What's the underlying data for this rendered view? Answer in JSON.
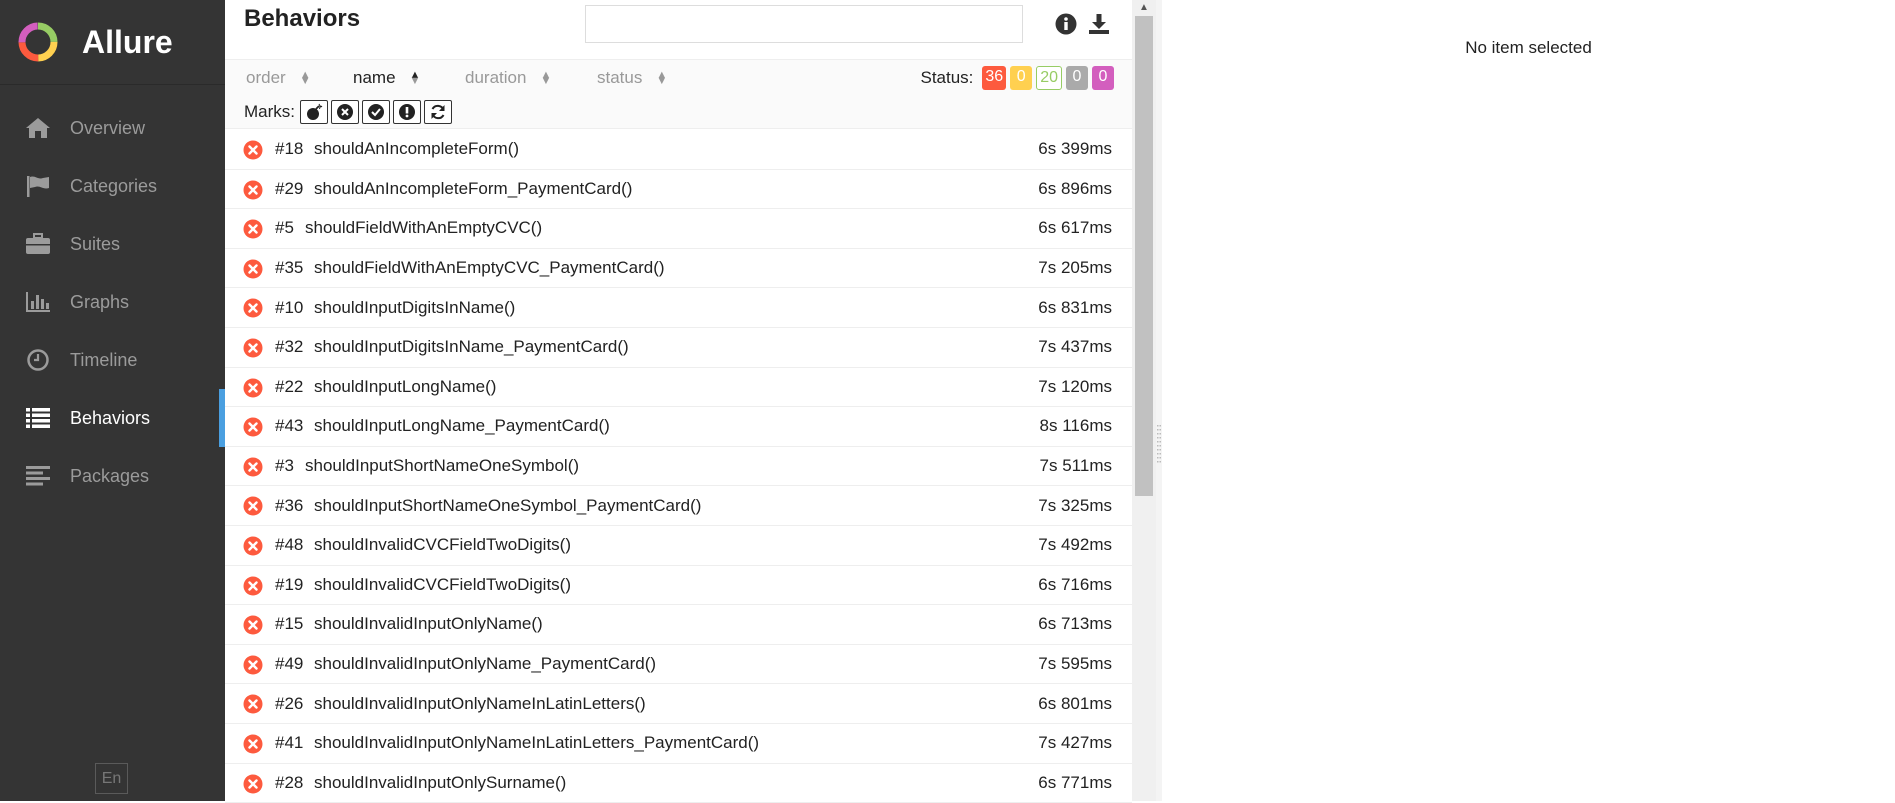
{
  "app": {
    "name": "Allure"
  },
  "sidebar": {
    "items": [
      {
        "label": "Overview",
        "icon": "home-icon",
        "active": false
      },
      {
        "label": "Categories",
        "icon": "flag-icon",
        "active": false
      },
      {
        "label": "Suites",
        "icon": "briefcase-icon",
        "active": false
      },
      {
        "label": "Graphs",
        "icon": "bar-chart-icon",
        "active": false
      },
      {
        "label": "Timeline",
        "icon": "clock-icon",
        "active": false
      },
      {
        "label": "Behaviors",
        "icon": "list-icon",
        "active": true
      },
      {
        "label": "Packages",
        "icon": "align-left-icon",
        "active": false
      }
    ],
    "language": "En"
  },
  "pane": {
    "title": "Behaviors",
    "search": {
      "value": "",
      "placeholder": ""
    },
    "sort": {
      "order": "order",
      "name": "name",
      "duration": "duration",
      "status": "status"
    },
    "status_label": "Status:",
    "status_counts": {
      "failed": "36",
      "broken": "0",
      "passed": "20",
      "skipped": "0",
      "unknown": "0"
    },
    "marks_label": "Marks:"
  },
  "rows": [
    {
      "order": "#18",
      "name": "shouldAnIncompleteForm()",
      "duration": "6s 399ms"
    },
    {
      "order": "#29",
      "name": "shouldAnIncompleteForm_PaymentCard()",
      "duration": "6s 896ms"
    },
    {
      "order": "#5",
      "name": "shouldFieldWithAnEmptyCVC()",
      "duration": "6s 617ms"
    },
    {
      "order": "#35",
      "name": "shouldFieldWithAnEmptyCVC_PaymentCard()",
      "duration": "7s 205ms"
    },
    {
      "order": "#10",
      "name": "shouldInputDigitsInName()",
      "duration": "6s 831ms"
    },
    {
      "order": "#32",
      "name": "shouldInputDigitsInName_PaymentCard()",
      "duration": "7s 437ms"
    },
    {
      "order": "#22",
      "name": "shouldInputLongName()",
      "duration": "7s 120ms"
    },
    {
      "order": "#43",
      "name": "shouldInputLongName_PaymentCard()",
      "duration": "8s 116ms"
    },
    {
      "order": "#3",
      "name": "shouldInputShortNameOneSymbol()",
      "duration": "7s 511ms"
    },
    {
      "order": "#36",
      "name": "shouldInputShortNameOneSymbol_PaymentCard()",
      "duration": "7s 325ms"
    },
    {
      "order": "#48",
      "name": "shouldInvalidCVCFieldTwoDigits()",
      "duration": "7s 492ms"
    },
    {
      "order": "#19",
      "name": "shouldInvalidCVCFieldTwoDigits()",
      "duration": "6s 716ms"
    },
    {
      "order": "#15",
      "name": "shouldInvalidInputOnlyName()",
      "duration": "6s 713ms"
    },
    {
      "order": "#49",
      "name": "shouldInvalidInputOnlyName_PaymentCard()",
      "duration": "7s 595ms"
    },
    {
      "order": "#26",
      "name": "shouldInvalidInputOnlyNameInLatinLetters()",
      "duration": "6s 801ms"
    },
    {
      "order": "#41",
      "name": "shouldInvalidInputOnlyNameInLatinLetters_PaymentCard()",
      "duration": "7s 427ms"
    },
    {
      "order": "#28",
      "name": "shouldInvalidInputOnlySurname()",
      "duration": "6s 771ms"
    }
  ],
  "detail": {
    "empty_text": "No item selected"
  },
  "colors": {
    "sidebar_bg": "#343434",
    "active_accent": "#4a9fe0",
    "failed": "#fd5a3e",
    "broken": "#ffd050",
    "passed": "#97cc64",
    "skipped": "#aaaaaa",
    "unknown": "#d35ebe"
  }
}
